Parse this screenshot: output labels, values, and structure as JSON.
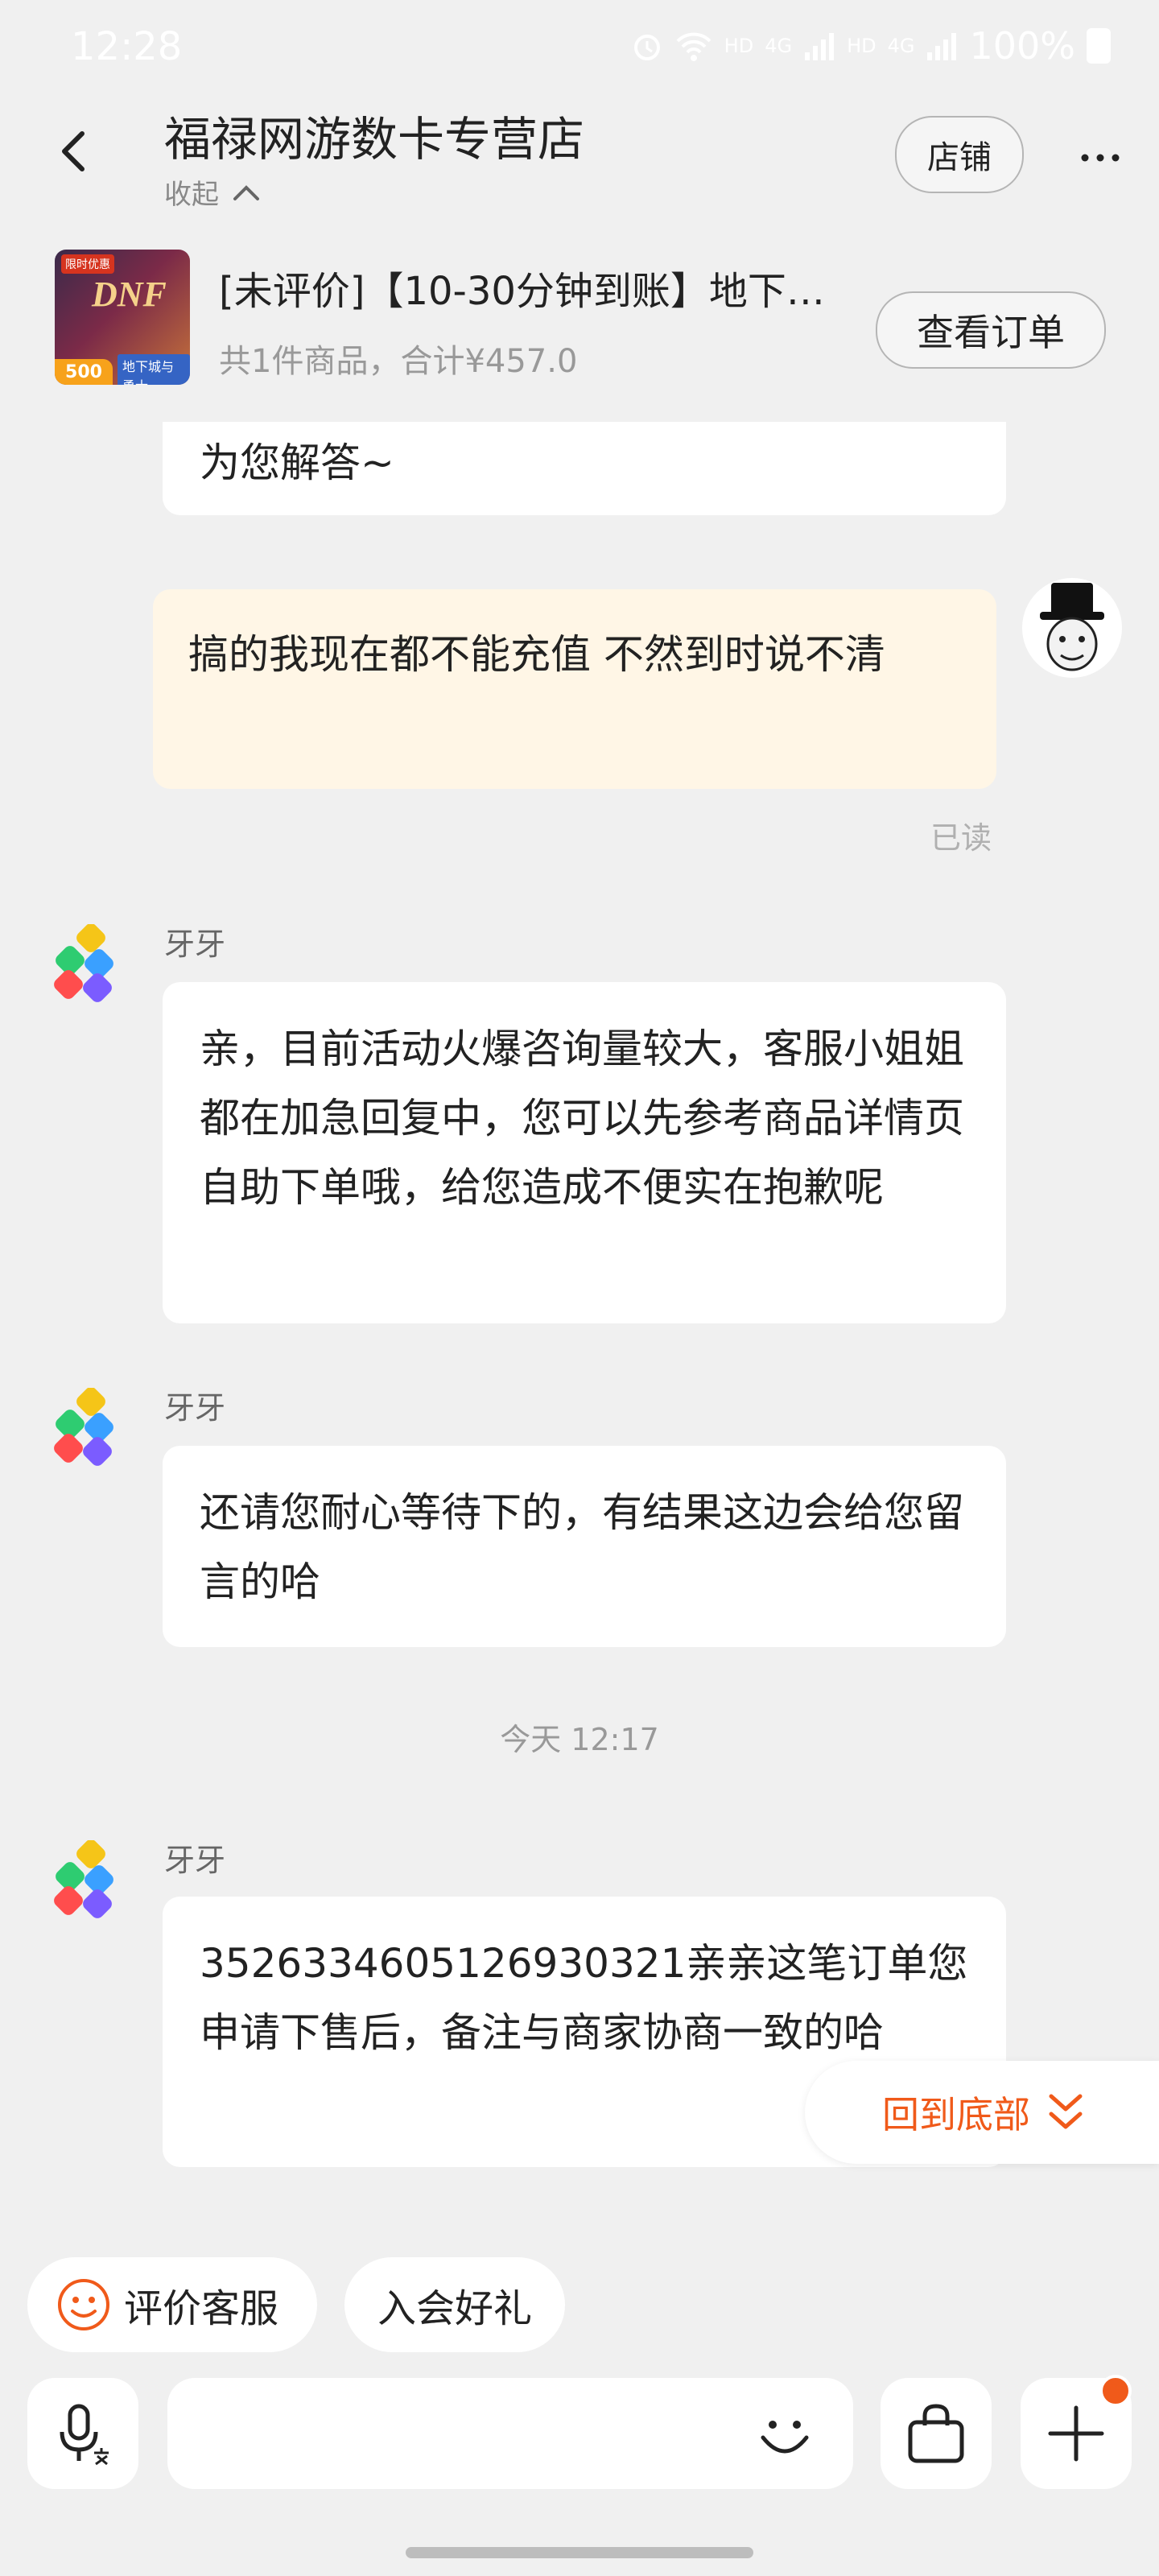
{
  "status_bar": {
    "time": "12:28",
    "hd1": "HD",
    "net1": "4G",
    "hd2": "HD",
    "net2": "4G",
    "battery": "100%"
  },
  "header": {
    "title": "福禄网游数卡专营店",
    "collapse_label": "收起",
    "store_button": "店铺"
  },
  "order": {
    "title": "[未评价]【10-30分钟到账】地下…",
    "summary": "共1件商品，合计¥457.0",
    "view_button": "查看订单",
    "thumb": {
      "top_badge": "限时优惠",
      "logo": "DNF",
      "game_name": "地下城与勇士",
      "amount": "500"
    }
  },
  "messages": [
    {
      "from": "agent",
      "text": "为您解答~"
    },
    {
      "from": "me",
      "text": "搞的我现在都不能充值 不然到时说不清",
      "status": "已读"
    },
    {
      "from": "agent",
      "sender": "牙牙",
      "text": "亲，目前活动火爆咨询量较大，客服小姐姐都在加急回复中，您可以先参考商品详情页自助下单哦，给您造成不便实在抱歉呢"
    },
    {
      "from": "agent",
      "sender": "牙牙",
      "text": "还请您耐心等待下的，有结果这边会给您留言的哈"
    },
    {
      "type": "time",
      "text": "今天 12:17"
    },
    {
      "from": "agent",
      "sender": "牙牙",
      "text": "3526334605126930321亲亲这笔订单您申请下售后，备注与商家协商一致的哈"
    }
  ],
  "back_to_bottom": "回到底部",
  "quick_actions": [
    "评价客服",
    "入会好礼"
  ],
  "colors": {
    "accent": "#f05a1a",
    "bubble_mine": "#fff6e6",
    "bubble_agent": "#ffffff",
    "background": "#f0f0f0"
  },
  "icons": [
    "back-arrow-icon",
    "chevron-up-icon",
    "more-icon",
    "smile-icon",
    "voice-input-icon",
    "emoji-icon",
    "shopping-bag-icon",
    "plus-icon",
    "double-chevron-down-icon"
  ]
}
